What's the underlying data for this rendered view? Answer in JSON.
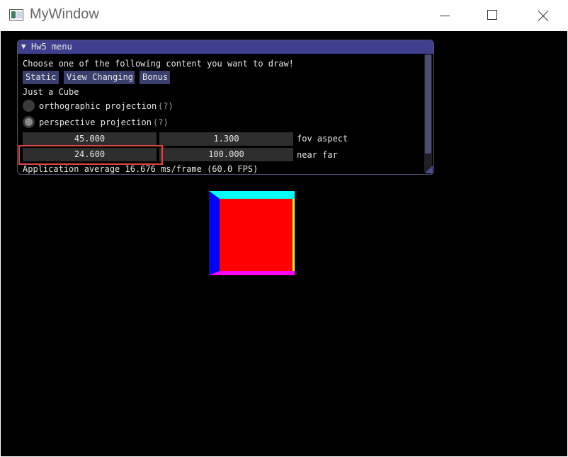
{
  "window": {
    "title": "MyWindow"
  },
  "panel": {
    "title": "Hw5 menu",
    "prompt": "Choose one of the following content you want to draw!",
    "buttons": [
      "Static",
      "View Changing",
      "Bonus"
    ],
    "current_content": "Just a Cube",
    "radio_ortho": {
      "label": "orthographic projection",
      "help": "(?)",
      "selected": false
    },
    "radio_persp": {
      "label": "perspective projection",
      "help": "(?)",
      "selected": true
    },
    "fov": "45.000",
    "aspect": "1.300",
    "fov_aspect_label": "fov aspect",
    "near": "24.600",
    "far": "100.000",
    "near_far_label": "near far",
    "status": "Application average 16.676 ms/frame (60.0 FPS)"
  },
  "colors": {
    "menu_header": "#403f8e",
    "button_bg": "#3b3f6e",
    "field_bg": "#2e2e2e",
    "highlight_box": "#e04545",
    "cube_front": "#ff0000",
    "cube_top": "#00ffff",
    "cube_left": "#0000ff",
    "cube_bottom": "#ff00ff",
    "cube_right": "#ffff00"
  }
}
